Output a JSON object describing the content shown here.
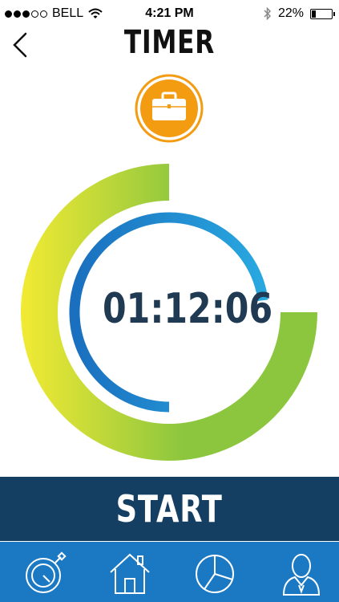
{
  "status_bar": {
    "carrier": "BELL",
    "time": "4:21 PM",
    "battery_text": "22%",
    "battery_level": 0.22,
    "signal_bars_filled": 3,
    "signal_bars_total": 5,
    "icons": [
      "wifi-icon",
      "bluetooth-icon",
      "battery-icon"
    ]
  },
  "header": {
    "title": "TIMER",
    "back_icon": "chevron-left-icon",
    "category_icon": "briefcase-icon",
    "category_color": "#f39c12"
  },
  "timer": {
    "display": "01:12:06",
    "outer_progress": 0.75,
    "inner_progress": 0.73,
    "colors": {
      "outer_start": "#f2ea33",
      "outer_end": "#8cc63f",
      "inner_start": "#1a6fbf",
      "inner_end": "#29a8e0",
      "text": "#1f3a52"
    }
  },
  "start_button": {
    "label": "START",
    "color": "#143e62"
  },
  "tab_bar": {
    "color": "#1b79c4",
    "tabs": [
      {
        "icon": "stopwatch-icon"
      },
      {
        "icon": "home-icon"
      },
      {
        "icon": "pie-chart-icon"
      },
      {
        "icon": "profile-icon"
      }
    ]
  }
}
